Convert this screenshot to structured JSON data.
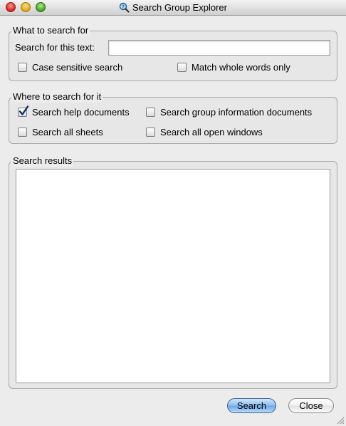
{
  "window": {
    "title": "Search Group Explorer"
  },
  "what_group": {
    "legend": "What to search for",
    "search_label": "Search for this text:",
    "search_value": "",
    "case_sensitive": {
      "label": "Case sensitive search",
      "checked": false
    },
    "whole_words": {
      "label": "Match whole words only",
      "checked": false
    }
  },
  "where_group": {
    "legend": "Where to search for it",
    "help_docs": {
      "label": "Search help documents",
      "checked": true
    },
    "group_info": {
      "label": "Search group information documents",
      "checked": false
    },
    "all_sheets": {
      "label": "Search all sheets",
      "checked": false
    },
    "open_windows": {
      "label": "Search all open windows",
      "checked": false
    }
  },
  "results_group": {
    "legend": "Search results"
  },
  "buttons": {
    "search": "Search",
    "close": "Close"
  }
}
